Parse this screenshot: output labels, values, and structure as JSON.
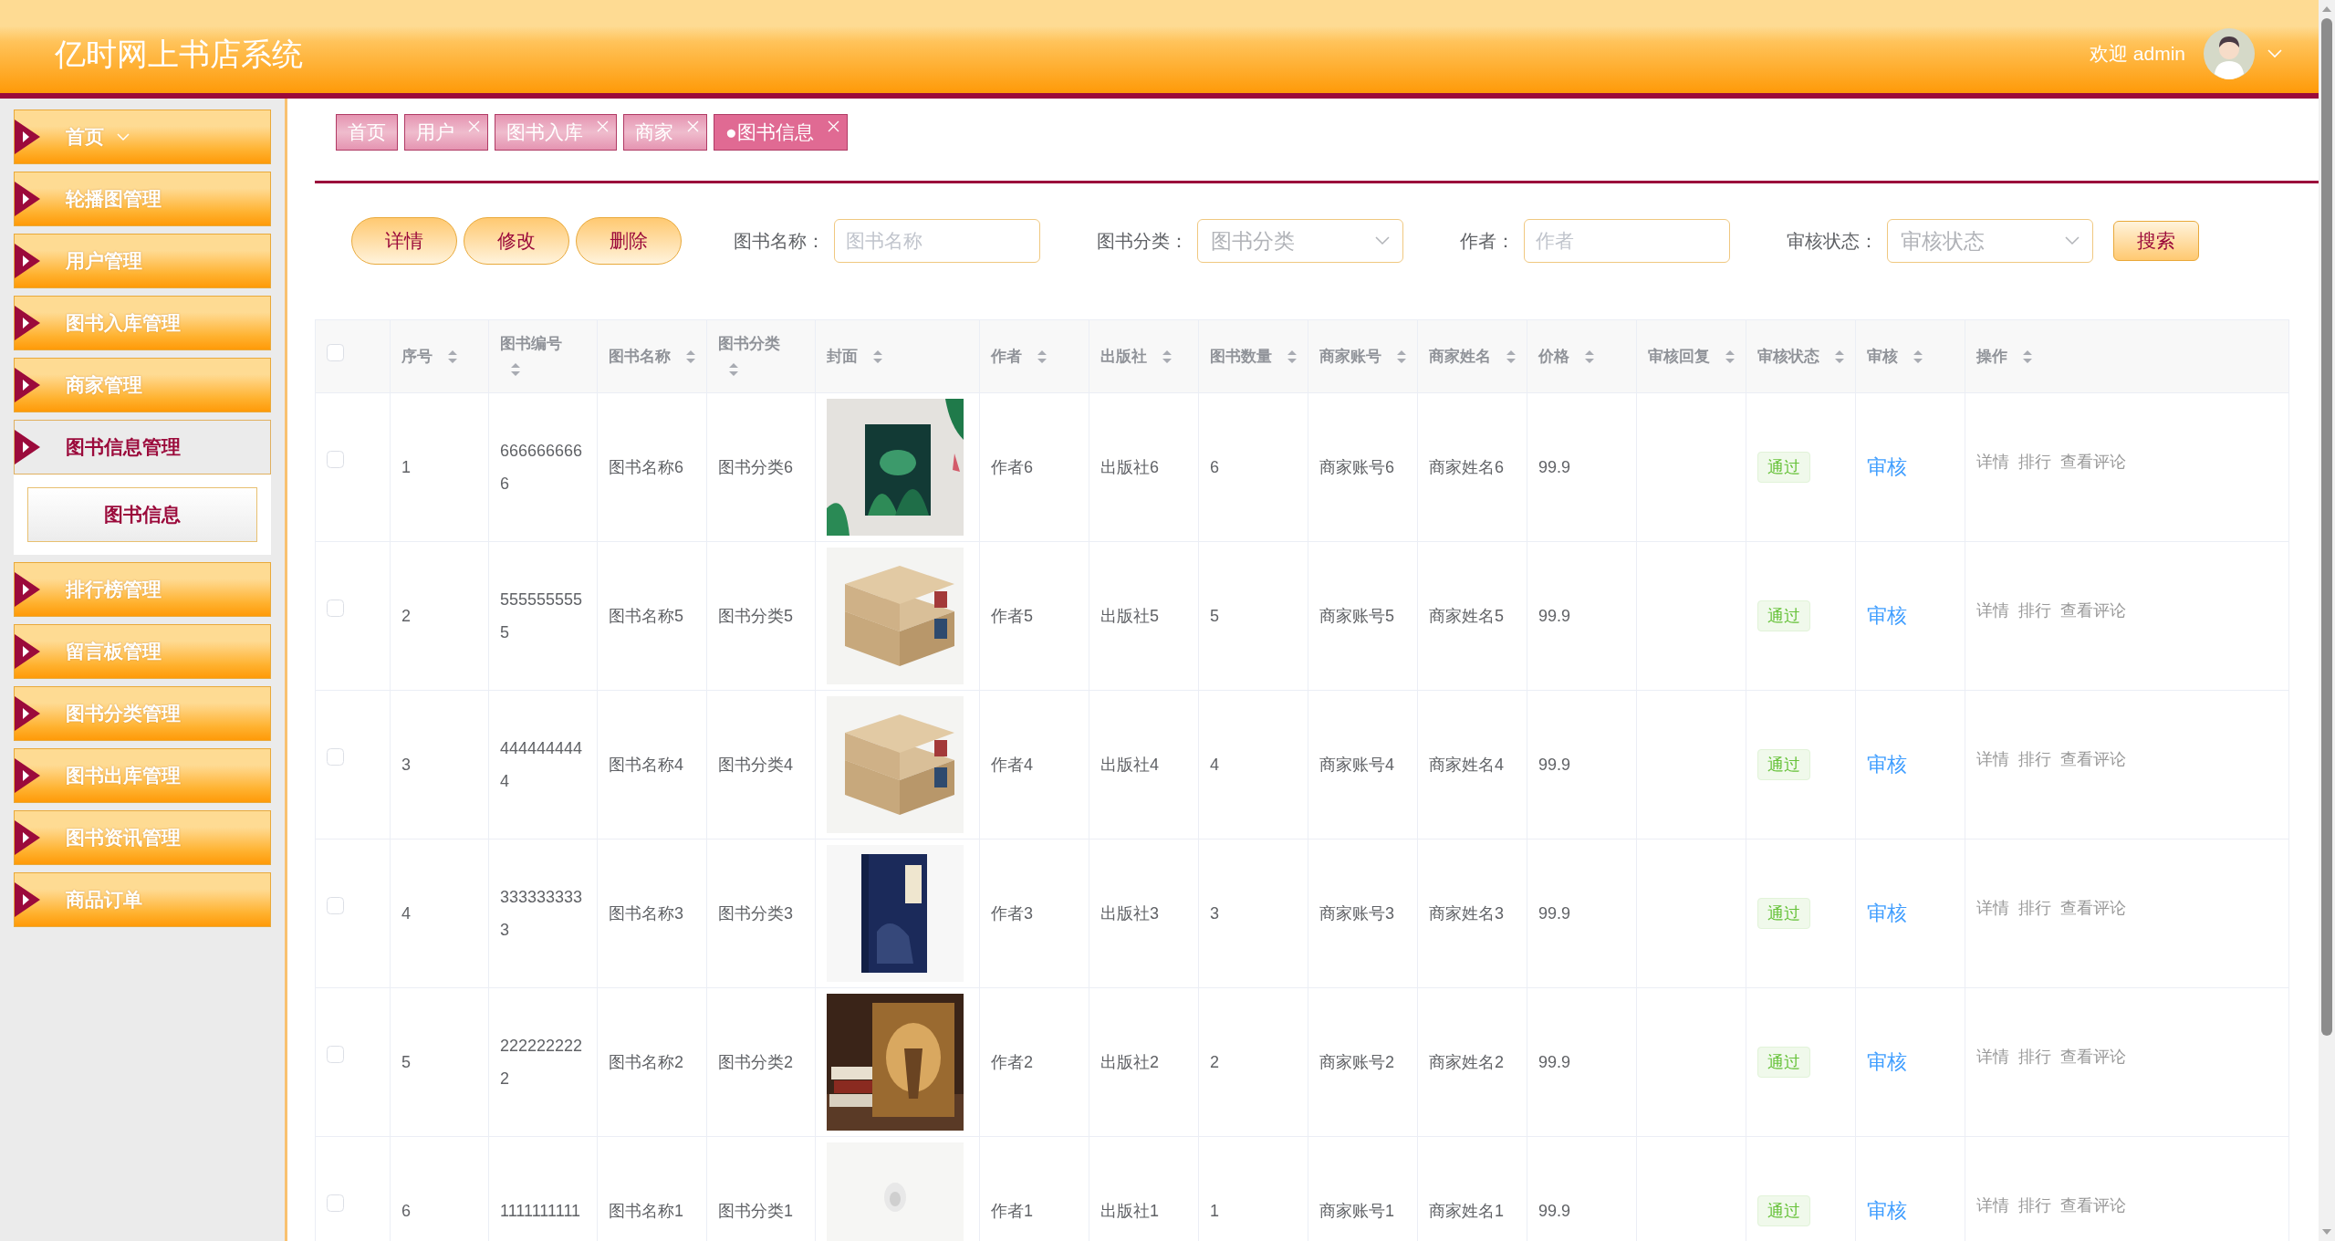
{
  "header": {
    "title": "亿时网上书店系统",
    "welcome": "欢迎 admin"
  },
  "sidebar": {
    "items": [
      {
        "label": "首页",
        "kind": "dropdown",
        "expanded": false
      },
      {
        "label": "轮播图管理",
        "kind": "link",
        "expanded": false
      },
      {
        "label": "用户管理",
        "kind": "link",
        "expanded": false
      },
      {
        "label": "图书入库管理",
        "kind": "link",
        "expanded": false
      },
      {
        "label": "商家管理",
        "kind": "link",
        "expanded": false
      },
      {
        "label": "图书信息管理",
        "kind": "link",
        "expanded": true,
        "children": [
          {
            "label": "图书信息",
            "selected": true
          }
        ]
      },
      {
        "label": "排行榜管理",
        "kind": "link",
        "expanded": false
      },
      {
        "label": "留言板管理",
        "kind": "link",
        "expanded": false
      },
      {
        "label": "图书分类管理",
        "kind": "link",
        "expanded": false
      },
      {
        "label": "图书出库管理",
        "kind": "link",
        "expanded": false
      },
      {
        "label": "图书资讯管理",
        "kind": "link",
        "expanded": false
      },
      {
        "label": "商品订单",
        "kind": "link",
        "expanded": false
      }
    ]
  },
  "tabs": [
    {
      "label": "首页",
      "closable": false,
      "selected": false
    },
    {
      "label": "用户",
      "closable": true,
      "selected": false
    },
    {
      "label": "图书入库",
      "closable": true,
      "selected": false
    },
    {
      "label": "商家",
      "closable": true,
      "selected": false
    },
    {
      "label": "●图书信息",
      "closable": true,
      "selected": true
    }
  ],
  "actions": [
    "详情",
    "修改",
    "删除"
  ],
  "filters": [
    {
      "kind": "input",
      "label": "图书名称：",
      "placeholder": "图书名称"
    },
    {
      "kind": "select",
      "label": "图书分类：",
      "placeholder": "图书分类"
    },
    {
      "kind": "input",
      "label": "作者：",
      "placeholder": "作者"
    },
    {
      "kind": "select",
      "label": "审核状态：",
      "placeholder": "审核状态"
    }
  ],
  "search_button": "搜索",
  "table": {
    "select_all": false,
    "columns": [
      {
        "label": "序号"
      },
      {
        "label": "图书编号"
      },
      {
        "label": "图书名称"
      },
      {
        "label": "图书分类"
      },
      {
        "label": "封面"
      },
      {
        "label": "作者"
      },
      {
        "label": "出版社"
      },
      {
        "label": "图书数量"
      },
      {
        "label": "商家账号"
      },
      {
        "label": "商家姓名"
      },
      {
        "label": "价格"
      },
      {
        "label": "审核回复"
      },
      {
        "label": "审核状态"
      },
      {
        "label": "审核"
      },
      {
        "label": "操作"
      }
    ],
    "rows": [
      {
        "checked": false,
        "index": "1",
        "code": "6666666666",
        "name": "图书名称6",
        "category": "图书分类6",
        "cover": {
          "kind": "picture"
        },
        "author": "作者6",
        "publisher": "出版社6",
        "quantity": "6",
        "merchant_account": "商家账号6",
        "merchant_name": "商家姓名6",
        "price": "99.9",
        "status": "通过",
        "review": "审核",
        "operations": [
          "详情",
          "排行",
          "查看评论"
        ]
      },
      {
        "checked": false,
        "index": "2",
        "code": "5555555555",
        "name": "图书名称5",
        "category": "图书分类5",
        "cover": {
          "kind": "picture"
        },
        "author": "作者5",
        "publisher": "出版社5",
        "quantity": "5",
        "merchant_account": "商家账号5",
        "merchant_name": "商家姓名5",
        "price": "99.9",
        "status": "通过",
        "review": "审核",
        "operations": [
          "详情",
          "排行",
          "查看评论"
        ]
      },
      {
        "checked": false,
        "index": "3",
        "code": "4444444444",
        "name": "图书名称4",
        "category": "图书分类4",
        "cover": {
          "kind": "picture"
        },
        "author": "作者4",
        "publisher": "出版社4",
        "quantity": "4",
        "merchant_account": "商家账号4",
        "merchant_name": "商家姓名4",
        "price": "99.9",
        "status": "通过",
        "review": "审核",
        "operations": [
          "详情",
          "排行",
          "查看评论"
        ]
      },
      {
        "checked": false,
        "index": "4",
        "code": "3333333333",
        "name": "图书名称3",
        "category": "图书分类3",
        "cover": {
          "kind": "picture"
        },
        "author": "作者3",
        "publisher": "出版社3",
        "quantity": "3",
        "merchant_account": "商家账号3",
        "merchant_name": "商家姓名3",
        "price": "99.9",
        "status": "通过",
        "review": "审核",
        "operations": [
          "详情",
          "排行",
          "查看评论"
        ]
      },
      {
        "checked": false,
        "index": "5",
        "code": "2222222222",
        "name": "图书名称2",
        "category": "图书分类2",
        "cover": {
          "kind": "picture"
        },
        "author": "作者2",
        "publisher": "出版社2",
        "quantity": "2",
        "merchant_account": "商家账号2",
        "merchant_name": "商家姓名2",
        "price": "99.9",
        "status": "通过",
        "review": "审核",
        "operations": [
          "详情",
          "排行",
          "查看评论"
        ]
      },
      {
        "checked": false,
        "index": "6",
        "code": "1111111111",
        "name": "图书名称1",
        "category": "图书分类1",
        "cover": {
          "kind": "picture"
        },
        "author": "作者1",
        "publisher": "出版社1",
        "quantity": "1",
        "merchant_account": "商家账号1",
        "merchant_name": "商家姓名1",
        "price": "99.9",
        "status": "通过",
        "review": "审核",
        "operations": [
          "详情",
          "排行",
          "查看评论"
        ]
      }
    ]
  }
}
